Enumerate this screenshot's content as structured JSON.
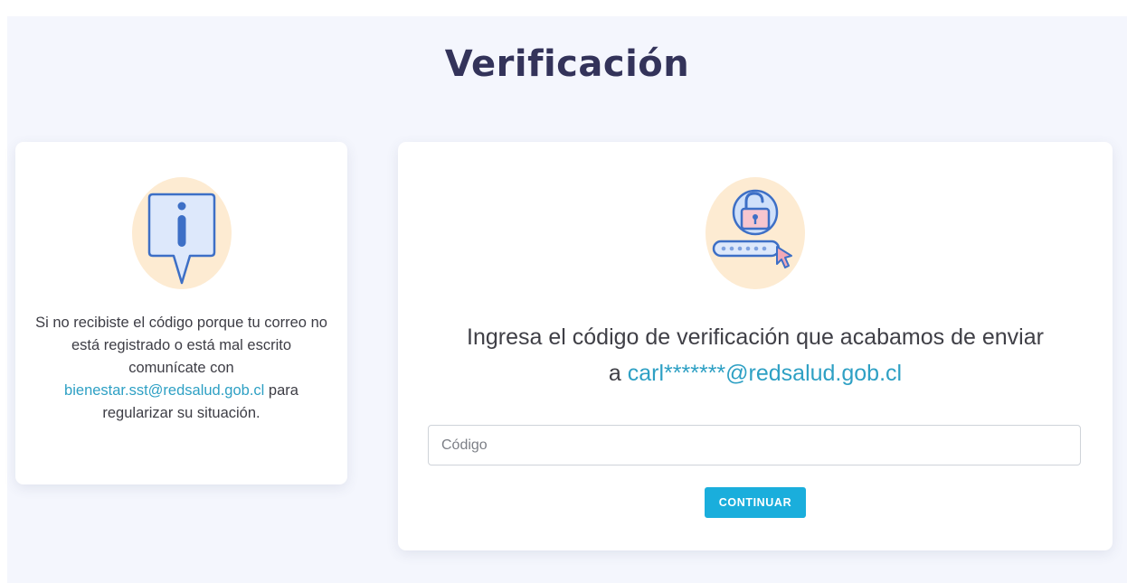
{
  "page": {
    "title": "Verificación"
  },
  "info_card": {
    "icon": "info-speech-bubble-icon",
    "text_before": "Si no recibiste el código porque tu correo no está registrado o está mal escrito comunícate con ",
    "email_link": "bienestar.sst@redsalud.gob.cl",
    "text_after": " para regularizar su situación."
  },
  "verify_card": {
    "icon": "unlocked-padlock-password-icon",
    "prompt_line1": "Ingresa el código de verificación que acabamos de enviar",
    "prompt_line2_prefix": "a ",
    "masked_email": "carl*******@redsalud.gob.cl",
    "code_input": {
      "placeholder": "Código",
      "value": ""
    },
    "continue_label": "CONTINUAR"
  },
  "colors": {
    "page_background": "#f4f6fd",
    "title": "#33335a",
    "link": "#2ea0c4",
    "button": "#1aaedc",
    "icon_circle": "#fdebd2",
    "icon_blue": "#3d6fc6"
  }
}
